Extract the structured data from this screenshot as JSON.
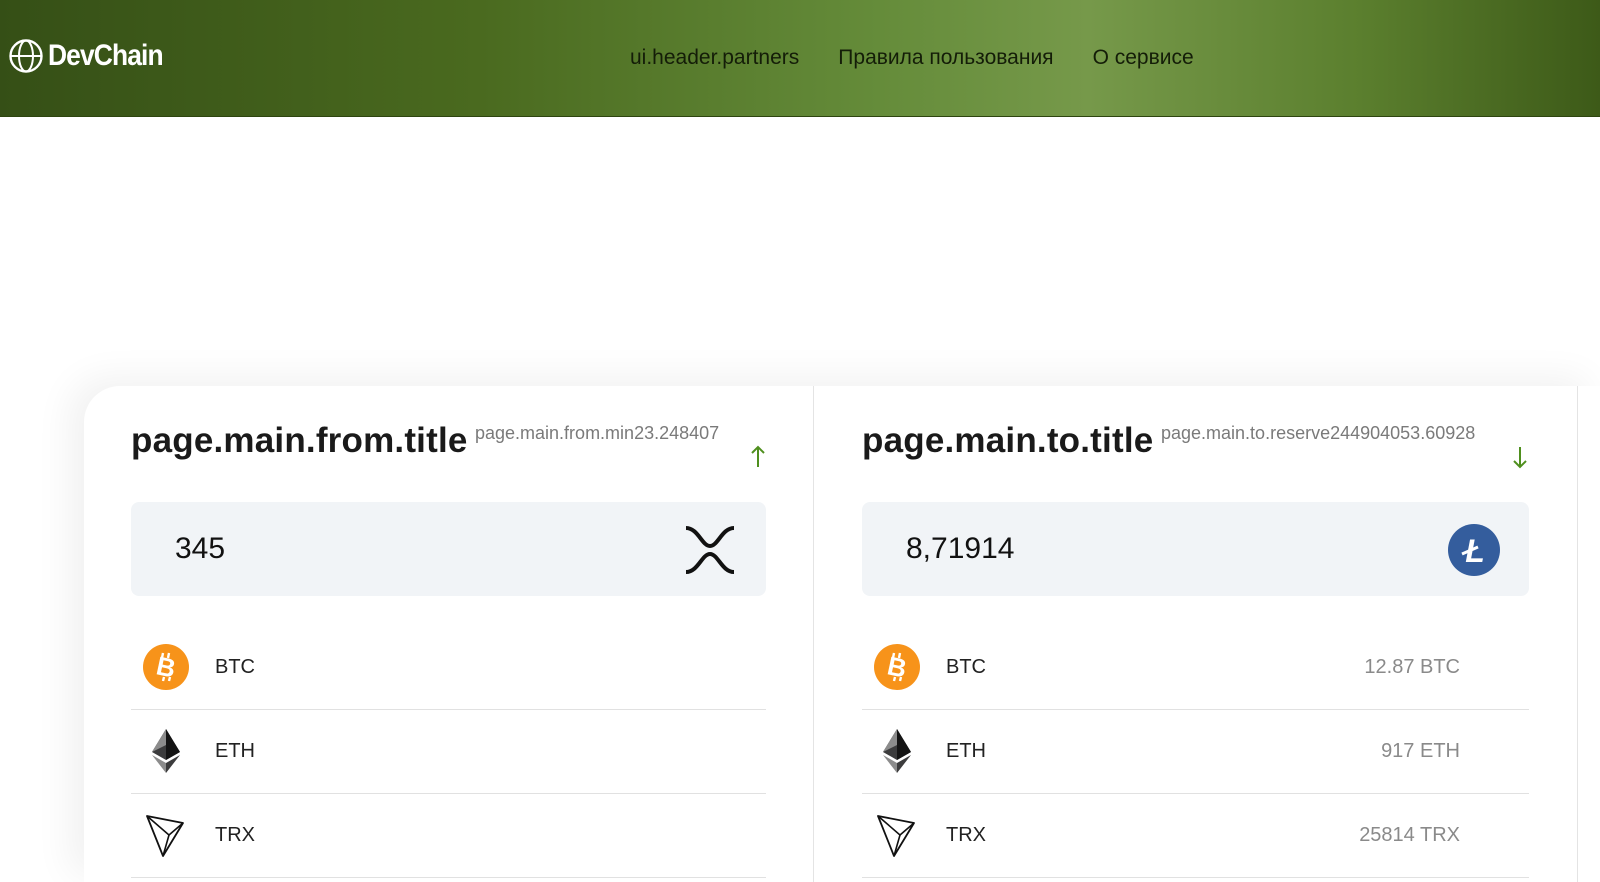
{
  "header": {
    "logo": "DevChain",
    "nav": [
      "ui.header.partners",
      "Правила пользования",
      "О сервисе"
    ]
  },
  "from": {
    "title": "page.main.from.title",
    "hint": "page.main.from.min23.248407",
    "amount": "345",
    "amount_icon": "xrp-icon",
    "currencies": [
      {
        "name": "BTC",
        "icon": "bitcoin-icon"
      },
      {
        "name": "ETH",
        "icon": "ethereum-icon"
      },
      {
        "name": "TRX",
        "icon": "tron-icon"
      }
    ]
  },
  "to": {
    "title": "page.main.to.title",
    "hint": "page.main.to.reserve244904053.60928",
    "amount": "8,71914",
    "amount_icon": "litecoin-icon",
    "currencies": [
      {
        "name": "BTC",
        "icon": "bitcoin-icon",
        "reserve": "12.87 BTC"
      },
      {
        "name": "ETH",
        "icon": "ethereum-icon",
        "reserve": "917 ETH"
      },
      {
        "name": "TRX",
        "icon": "tron-icon",
        "reserve": "25814 TRX"
      }
    ]
  },
  "colors": {
    "header_dark": "#354f16",
    "header_light": "#76994a",
    "accent_arrow": "#4f8f1e",
    "bitcoin": "#f7931a",
    "litecoin": "#345d9d",
    "input_bg": "#f1f4f7"
  }
}
